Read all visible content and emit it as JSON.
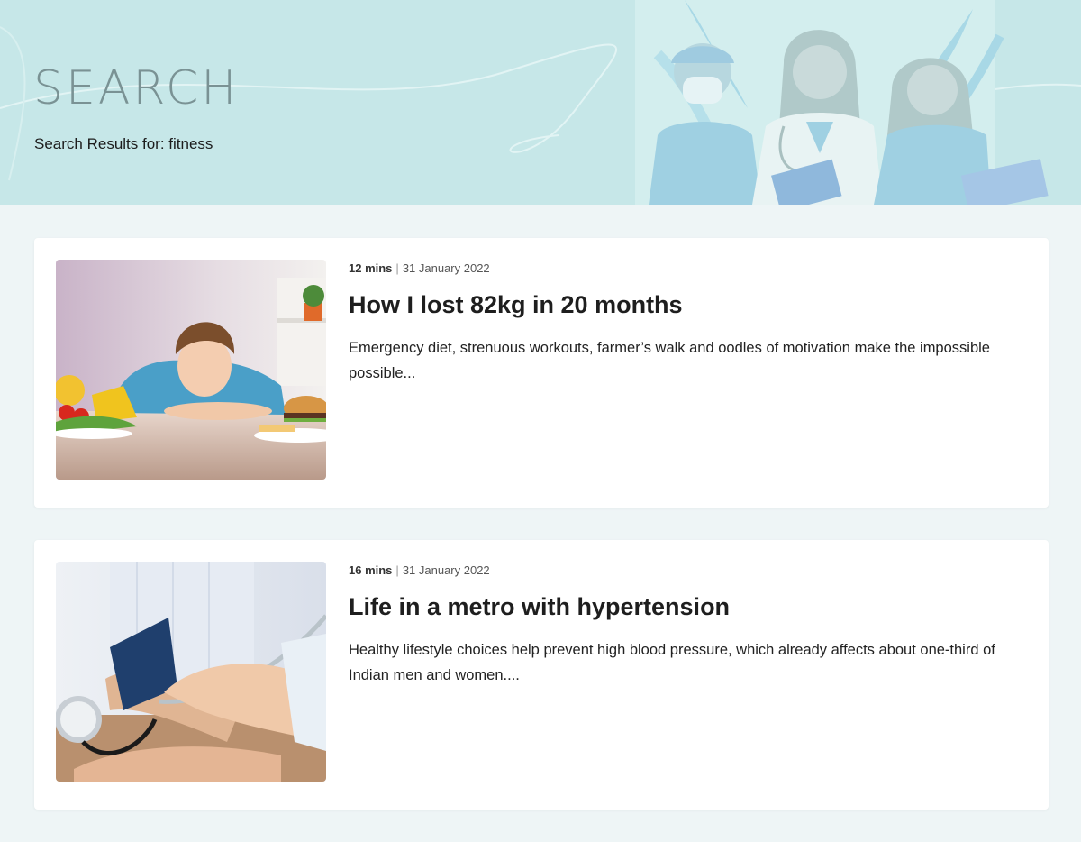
{
  "header": {
    "title": "SEARCH",
    "subtitle": "Search Results for: fitness"
  },
  "results": [
    {
      "duration": "12 mins",
      "separator": "|",
      "date": "31 January 2022",
      "title": "How I lost 82kg in 20 months",
      "excerpt": "Emergency diet, strenuous workouts, farmer’s walk and oodles of motivation make the impossible possible..."
    },
    {
      "duration": "16 mins",
      "separator": "|",
      "date": "31 January 2022",
      "title": "Life in a metro with hypertension",
      "excerpt": "Healthy lifestyle choices help prevent high blood pressure, which already affects about one-third of Indian men and women...."
    }
  ],
  "colors": {
    "hero_bg": "#c6e7e8",
    "page_bg": "#eef5f6",
    "title_gray": "#7a9294"
  }
}
